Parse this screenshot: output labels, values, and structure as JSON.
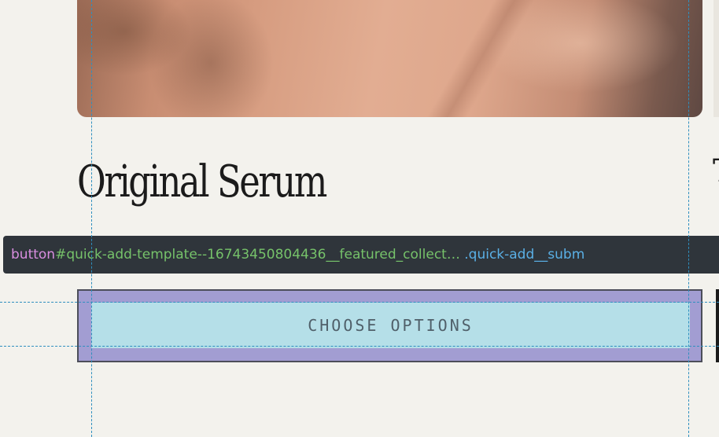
{
  "product": {
    "title": "Original Serum",
    "price_partial": "",
    "image_alt": "Close-up of skin"
  },
  "inspector": {
    "tag": "button",
    "id": "#quick-add-template--16743450804436__featured_collect…",
    "classes": " .quick-add__subm"
  },
  "button": {
    "label": "CHOOSE OPTIONS"
  },
  "next_card": {
    "title_first_letter": "T"
  },
  "colors": {
    "background": "#f3f2ed",
    "tooltip_bg": "#2f353b",
    "tag_color": "#d98ee0",
    "id_color": "#76c26a",
    "class_color": "#5ab0e6",
    "button_content_highlight": "#b5dfe8",
    "button_margin_highlight": "#a29dd2",
    "guide_line": "#2e8fbf"
  }
}
